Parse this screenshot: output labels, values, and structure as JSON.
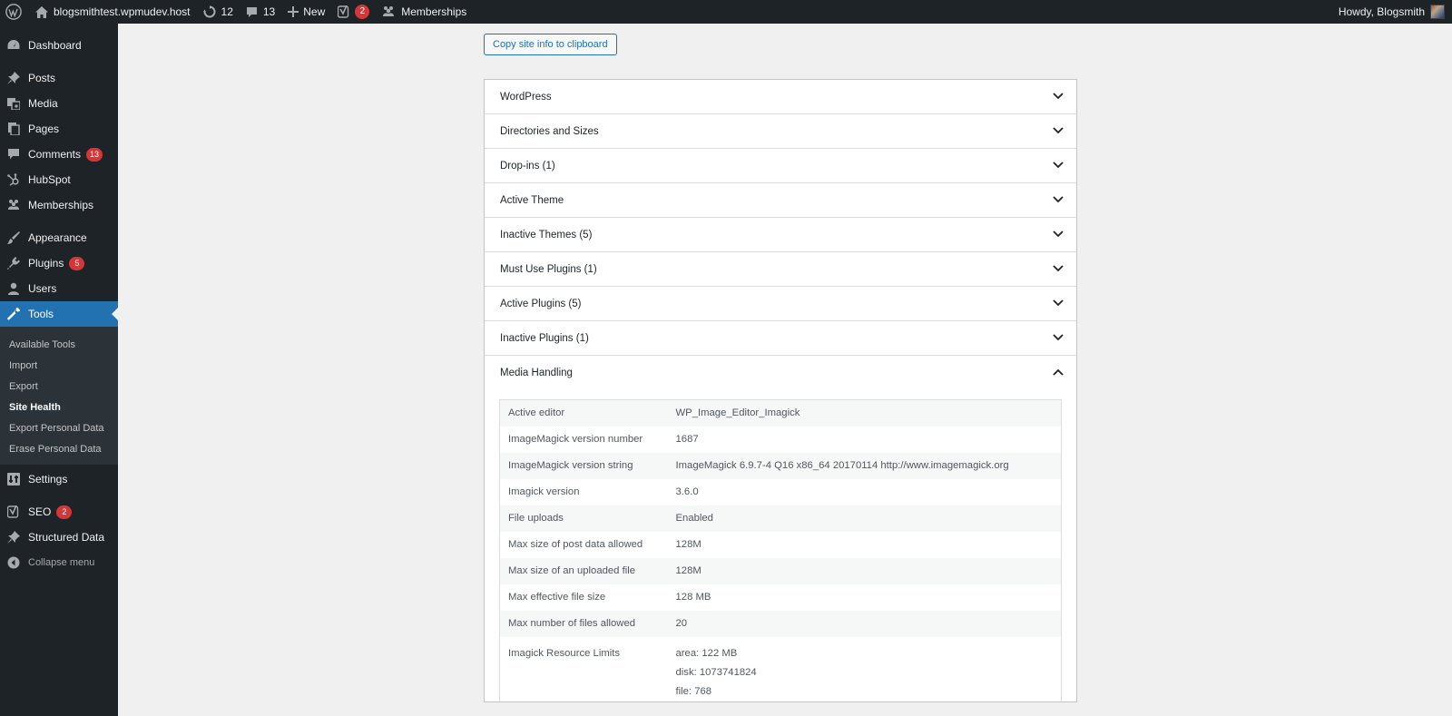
{
  "adminbar": {
    "site_name": "blogsmithtest.wpmudev.host",
    "updates_count": "12",
    "comments_count": "13",
    "new_label": "New",
    "yoast_badge": "2",
    "memberships_label": "Memberships",
    "howdy": "Howdy, Blogsmith"
  },
  "menu": {
    "dashboard": "Dashboard",
    "posts": "Posts",
    "media": "Media",
    "pages": "Pages",
    "comments": "Comments",
    "comments_badge": "13",
    "hubspot": "HubSpot",
    "memberships": "Memberships",
    "appearance": "Appearance",
    "plugins": "Plugins",
    "plugins_badge": "5",
    "users": "Users",
    "tools": "Tools",
    "settings": "Settings",
    "seo": "SEO",
    "seo_badge": "2",
    "structured_data": "Structured Data",
    "collapse": "Collapse menu"
  },
  "submenu": {
    "available_tools": "Available Tools",
    "import": "Import",
    "export": "Export",
    "site_health": "Site Health",
    "export_personal": "Export Personal Data",
    "erase_personal": "Erase Personal Data"
  },
  "main": {
    "copy_button": "Copy site info to clipboard",
    "sections": [
      "WordPress",
      "Directories and Sizes",
      "Drop-ins (1)",
      "Active Theme",
      "Inactive Themes (5)",
      "Must Use Plugins (1)",
      "Active Plugins (5)",
      "Inactive Plugins (1)",
      "Media Handling"
    ],
    "media_rows": [
      {
        "label": "Active editor",
        "value": "WP_Image_Editor_Imagick"
      },
      {
        "label": "ImageMagick version number",
        "value": "1687"
      },
      {
        "label": "ImageMagick version string",
        "value": "ImageMagick 6.9.7-4 Q16 x86_64 20170114 http://www.imagemagick.org"
      },
      {
        "label": "Imagick version",
        "value": "3.6.0"
      },
      {
        "label": "File uploads",
        "value": "Enabled"
      },
      {
        "label": "Max size of post data allowed",
        "value": "128M"
      },
      {
        "label": "Max size of an uploaded file",
        "value": "128M"
      },
      {
        "label": "Max effective file size",
        "value": "128 MB"
      },
      {
        "label": "Max number of files allowed",
        "value": "20"
      }
    ],
    "resource_limits": {
      "label": "Imagick Resource Limits",
      "lines": [
        "area: 122 MB",
        "disk: 1073741824",
        "file: 768"
      ]
    }
  },
  "icons": {
    "wp": "wordpress-logo-icon",
    "home": "home-icon",
    "updates": "updates-icon",
    "comments": "comment-icon",
    "plus": "plus-icon",
    "yoast": "yoast-icon",
    "memberships": "memberships-icon",
    "chevron_down": "chevron-down-icon",
    "chevron_up": "chevron-up-icon"
  },
  "colors": {
    "accent": "#2271b1",
    "badge": "#d63638",
    "bar": "#1d2327"
  }
}
